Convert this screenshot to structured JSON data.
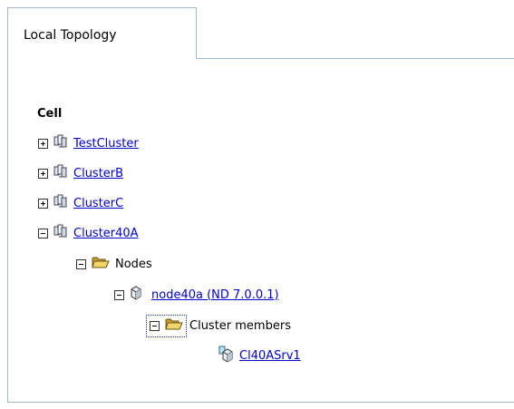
{
  "tabs": [
    {
      "label": "Local Topology"
    }
  ],
  "tree": {
    "root_label": "Cell",
    "clusters": [
      {
        "label": "TestCluster",
        "expanded": false
      },
      {
        "label": "ClusterB",
        "expanded": false
      },
      {
        "label": "ClusterC",
        "expanded": false
      },
      {
        "label": "Cluster40A",
        "expanded": true
      }
    ],
    "nodes_folder": {
      "label": "Nodes",
      "expanded": true
    },
    "node": {
      "label": "node40a (ND 7.0.0.1)",
      "expanded": true
    },
    "members_folder": {
      "label": "Cluster members",
      "expanded": true
    },
    "member": {
      "label": "Cl40ASrv1"
    }
  },
  "icons": {
    "cluster": "cluster-icon",
    "folder": "open-folder-icon",
    "node": "node-icon",
    "server": "cluster-member-server-icon",
    "expand": "expand-plus-icon",
    "collapse": "collapse-minus-icon"
  },
  "colors": {
    "link": "#0000cc",
    "border": "#9fb6cf",
    "folder": "#d4b24a"
  }
}
